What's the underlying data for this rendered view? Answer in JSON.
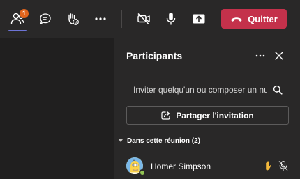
{
  "toolbar": {
    "participants_badge": "1",
    "quit_label": "Quitter",
    "quit_color": "#c4314b",
    "badge_color": "#e0641c",
    "accent_color": "#6d74d6",
    "icons": [
      "people-icon",
      "chat-icon",
      "raise-hand-icon",
      "more-icon",
      "camera-off-icon",
      "mic-icon",
      "share-screen-icon",
      "hangup-icon"
    ]
  },
  "panel": {
    "title": "Participants",
    "search_placeholder": "Inviter quelqu'un ou composer un numéro",
    "share_label": "Partager l'invitation",
    "section_label": "Dans cette réunion (2)",
    "participants": [
      {
        "name": "Homer Simpson",
        "status": "available",
        "hand_raised": true,
        "muted": true
      }
    ]
  }
}
